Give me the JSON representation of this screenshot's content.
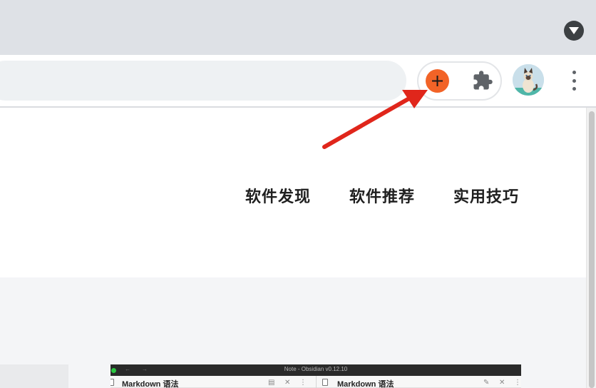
{
  "browser": {
    "tabstrip_icon": "tab-search-chevron-icon",
    "toolbar_icons": [
      "add-extension-icon",
      "puzzle-extensions-icon",
      "profile-avatar",
      "kebab-menu-icon"
    ],
    "accent_color": "#f26327",
    "annotation_color": "#e0261b"
  },
  "nav": {
    "items": [
      {
        "label": "软件发现"
      },
      {
        "label": "软件推荐"
      },
      {
        "label": "实用技巧"
      }
    ]
  },
  "embedded_screenshot": {
    "title": "Note - Obsidian v0.12.10",
    "back_glyph": "←",
    "forward_glyph": "→",
    "left_pane": {
      "label": "Markdown 语法"
    },
    "right_pane": {
      "label": "Markdown 语法"
    },
    "ctrl_preview": "▤",
    "ctrl_close": "✕",
    "ctrl_more": "⋮",
    "ctrl_edit": "✎"
  }
}
